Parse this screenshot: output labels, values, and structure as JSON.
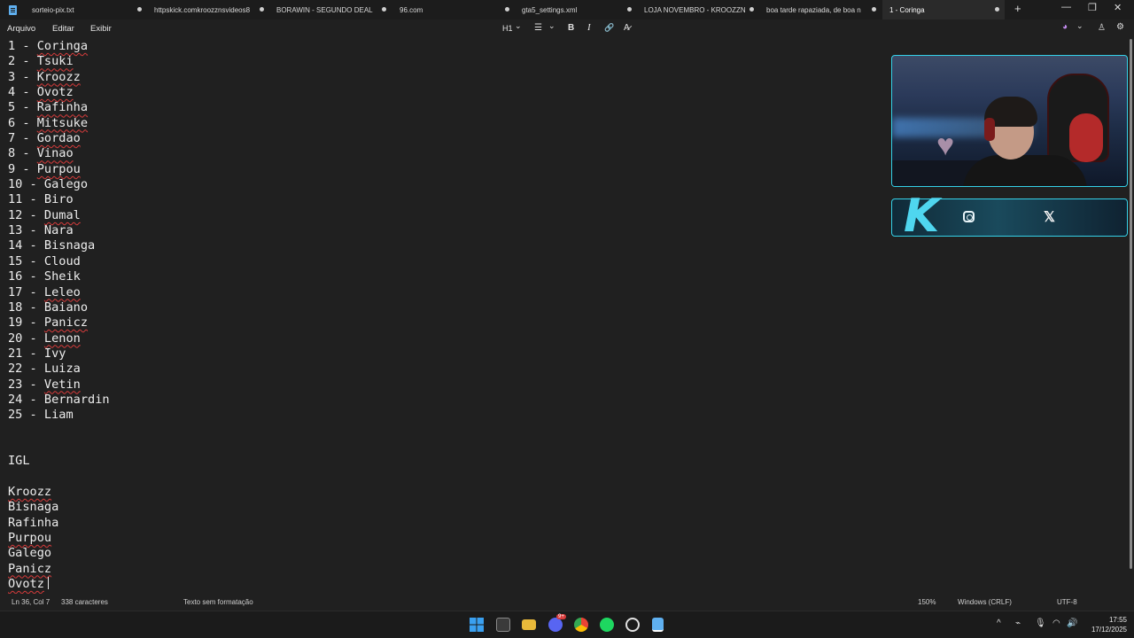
{
  "tabs": [
    {
      "label": "sorteio-pix.txt",
      "active": false
    },
    {
      "label": "httpskick.comkroozznsvideos8",
      "active": false
    },
    {
      "label": "BORAWIN - SEGUNDO DEAL",
      "active": false
    },
    {
      "label": "96.com",
      "active": false
    },
    {
      "label": "gta5_settings.xml",
      "active": false
    },
    {
      "label": "LOJA NOVEMBRO - KROOZZN",
      "active": false
    },
    {
      "label": "boa tarde rapaziada, de boa n",
      "active": false
    },
    {
      "label": "1 - Coringa",
      "active": true
    }
  ],
  "window_controls": {
    "new_tab": "+",
    "minimize": "—",
    "maximize": "❐",
    "close": "✕"
  },
  "menu": {
    "file": "Arquivo",
    "edit": "Editar",
    "view": "Exibir"
  },
  "toolbar": {
    "heading": "H1",
    "heading_chevron": "⌄",
    "list": "☰",
    "list_chevron": "⌄",
    "bold": "B",
    "italic": "I",
    "link": "🔗",
    "clear": "A̷",
    "copilot": "◕",
    "copilot_chevron": "⌄",
    "account": "♙",
    "settings": "⚙"
  },
  "document": {
    "lines": [
      {
        "prefix": "1 - ",
        "name": "Coringa",
        "squiggle": true
      },
      {
        "prefix": "2 - ",
        "name": "Tsuki",
        "squiggle": true
      },
      {
        "prefix": "3 - ",
        "name": "Kroozz",
        "squiggle": true
      },
      {
        "prefix": "4 - ",
        "name": "Ovotz",
        "squiggle": true
      },
      {
        "prefix": "5 - ",
        "name": "Rafinha",
        "squiggle": true
      },
      {
        "prefix": "6 - ",
        "name": "Mitsuke",
        "squiggle": true
      },
      {
        "prefix": "7 - ",
        "name": "Gordao",
        "squiggle": true
      },
      {
        "prefix": "8 - ",
        "name": "Vinao",
        "squiggle": true
      },
      {
        "prefix": "9 - ",
        "name": "Purpou",
        "squiggle": true
      },
      {
        "prefix": "10 - ",
        "name": "Galego",
        "squiggle": false
      },
      {
        "prefix": "11 - ",
        "name": "Biro",
        "squiggle": false
      },
      {
        "prefix": "12 - ",
        "name": "Dumal",
        "squiggle": true
      },
      {
        "prefix": "13 - ",
        "name": "Nara",
        "squiggle": false
      },
      {
        "prefix": "14 - ",
        "name": "Bisnaga",
        "squiggle": false
      },
      {
        "prefix": "15 - ",
        "name": "Cloud",
        "squiggle": false
      },
      {
        "prefix": "16 - ",
        "name": "Sheik",
        "squiggle": false
      },
      {
        "prefix": "17 - ",
        "name": "Leleo",
        "squiggle": true
      },
      {
        "prefix": "18 - ",
        "name": "Baiano",
        "squiggle": false
      },
      {
        "prefix": "19 - ",
        "name": "Panicz",
        "squiggle": true
      },
      {
        "prefix": "20 - ",
        "name": "Lenon",
        "squiggle": true
      },
      {
        "prefix": "21 - ",
        "name": "Ivy",
        "squiggle": false
      },
      {
        "prefix": "22 - ",
        "name": "Luiza",
        "squiggle": false
      },
      {
        "prefix": "23 - ",
        "name": "Vetin",
        "squiggle": true
      },
      {
        "prefix": "24 - ",
        "name": "Bernardin",
        "squiggle": false
      },
      {
        "prefix": "25 - ",
        "name": "Liam",
        "squiggle": false
      },
      {
        "prefix": "",
        "name": "",
        "squiggle": false
      },
      {
        "prefix": "",
        "name": "",
        "squiggle": false
      },
      {
        "prefix": "",
        "name": "IGL",
        "squiggle": false
      },
      {
        "prefix": "",
        "name": "",
        "squiggle": false
      },
      {
        "prefix": "",
        "name": "Kroozz",
        "squiggle": true
      },
      {
        "prefix": "",
        "name": "Bisnaga",
        "squiggle": false
      },
      {
        "prefix": "",
        "name": "Rafinha",
        "squiggle": false
      },
      {
        "prefix": "",
        "name": "Purpou",
        "squiggle": true
      },
      {
        "prefix": "",
        "name": "Galego",
        "squiggle": false
      },
      {
        "prefix": "",
        "name": "Panicz",
        "squiggle": true
      },
      {
        "prefix": "",
        "name": "Ovotz",
        "squiggle": true,
        "caret": true
      }
    ]
  },
  "status": {
    "position": "Ln 36, Col 7",
    "chars": "338 caracteres",
    "format": "Texto sem formatação",
    "zoom": "150%",
    "line_ending": "Windows (CRLF)",
    "encoding": "UTF-8"
  },
  "overlay": {
    "logo": "K",
    "x_icon": "𝕏"
  },
  "taskbar": {
    "tray_caret": "^",
    "discord_badge": "9+",
    "time": "17:55",
    "date": "17/12/2025"
  },
  "colors": {
    "accent_cyan": "#35d1e8",
    "squiggle_red": "#d83b3b",
    "notepad_blue": "#5fb0f0"
  }
}
